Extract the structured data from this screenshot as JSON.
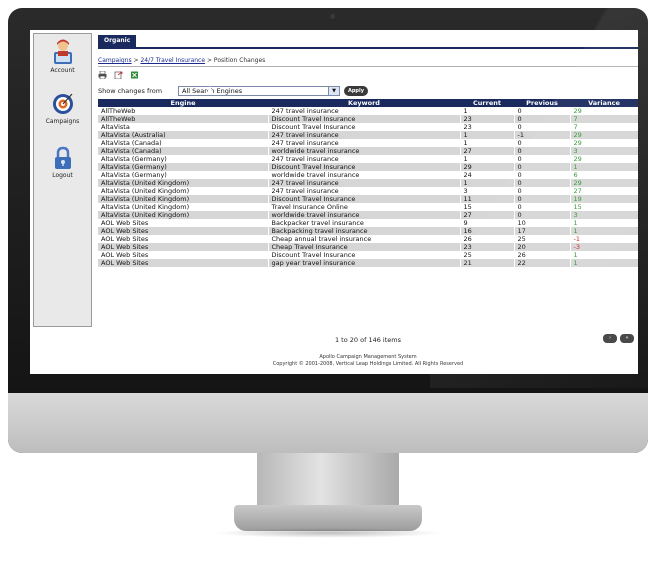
{
  "sidebar": {
    "items": [
      {
        "label": "Account",
        "icon": "account-icon"
      },
      {
        "label": "Campaigns",
        "icon": "target-icon"
      },
      {
        "label": "Logout",
        "icon": "lock-icon"
      }
    ]
  },
  "tab": {
    "label": "Organic"
  },
  "breadcrumb": {
    "items": [
      "Campaigns",
      "24/7 Travel Insurance"
    ],
    "current": "Position Changes",
    "separator": ">"
  },
  "toolbar": {
    "icons": [
      "print-icon",
      "export-icon",
      "excel-icon"
    ]
  },
  "filter": {
    "label": "Show changes from",
    "selected": "All Search Engines",
    "apply_label": "Apply"
  },
  "table": {
    "columns": [
      "Engine",
      "Keyword",
      "Current",
      "Previous",
      "Variance"
    ],
    "rows": [
      [
        "AllTheWeb",
        "247 travel insurance",
        "1",
        "0",
        "29"
      ],
      [
        "AllTheWeb",
        "Discount Travel Insurance",
        "23",
        "0",
        "7"
      ],
      [
        "AltaVista",
        "Discount Travel Insurance",
        "23",
        "0",
        "7"
      ],
      [
        "AltaVista (Australia)",
        "247 travel insurance",
        "1",
        "-1",
        "29"
      ],
      [
        "AltaVista (Canada)",
        "247 travel insurance",
        "1",
        "0",
        "29"
      ],
      [
        "AltaVista (Canada)",
        "worldwide travel insurance",
        "27",
        "0",
        "3"
      ],
      [
        "AltaVista (Germany)",
        "247 travel insurance",
        "1",
        "0",
        "29"
      ],
      [
        "AltaVista (Germany)",
        "Discount Travel Insurance",
        "29",
        "0",
        "1"
      ],
      [
        "AltaVista (Germany)",
        "worldwide travel insurance",
        "24",
        "0",
        "6"
      ],
      [
        "AltaVista (United Kingdom)",
        "247 travel insurance",
        "1",
        "0",
        "29"
      ],
      [
        "AltaVista (United Kingdom)",
        "247 travel insurance",
        "3",
        "0",
        "27"
      ],
      [
        "AltaVista (United Kingdom)",
        "Discount Travel Insurance",
        "11",
        "0",
        "19"
      ],
      [
        "AltaVista (United Kingdom)",
        "Travel Insurance Online",
        "15",
        "0",
        "15"
      ],
      [
        "AltaVista (United Kingdom)",
        "worldwide travel insurance",
        "27",
        "0",
        "3"
      ],
      [
        "AOL Web Sites",
        "Backpacker travel insurance",
        "9",
        "10",
        "1"
      ],
      [
        "AOL Web Sites",
        "Backpacking travel insurance",
        "16",
        "17",
        "1"
      ],
      [
        "AOL Web Sites",
        "Cheap annual travel insurance",
        "26",
        "25",
        "-1"
      ],
      [
        "AOL Web Sites",
        "Cheap Travel Insurance",
        "23",
        "20",
        "-3"
      ],
      [
        "AOL Web Sites",
        "Discount Travel Insurance",
        "25",
        "26",
        "1"
      ],
      [
        "AOL Web Sites",
        "gap year travel insurance",
        "21",
        "22",
        "1"
      ]
    ]
  },
  "pager": {
    "text": "1 to 20 of 146 items",
    "next_label": "›",
    "last_label": "»"
  },
  "footer": {
    "line1": "Apollo Campaign Management System",
    "line2": "Copyright © 2001-2008, Vertical Leap Holdings Limited. All Rights Reserved"
  },
  "colors": {
    "header_navy": "#1a2a5e",
    "variance_positive": "#2a9a2a",
    "variance_negative": "#cc2222",
    "row_alt": "#d6d6d6"
  }
}
